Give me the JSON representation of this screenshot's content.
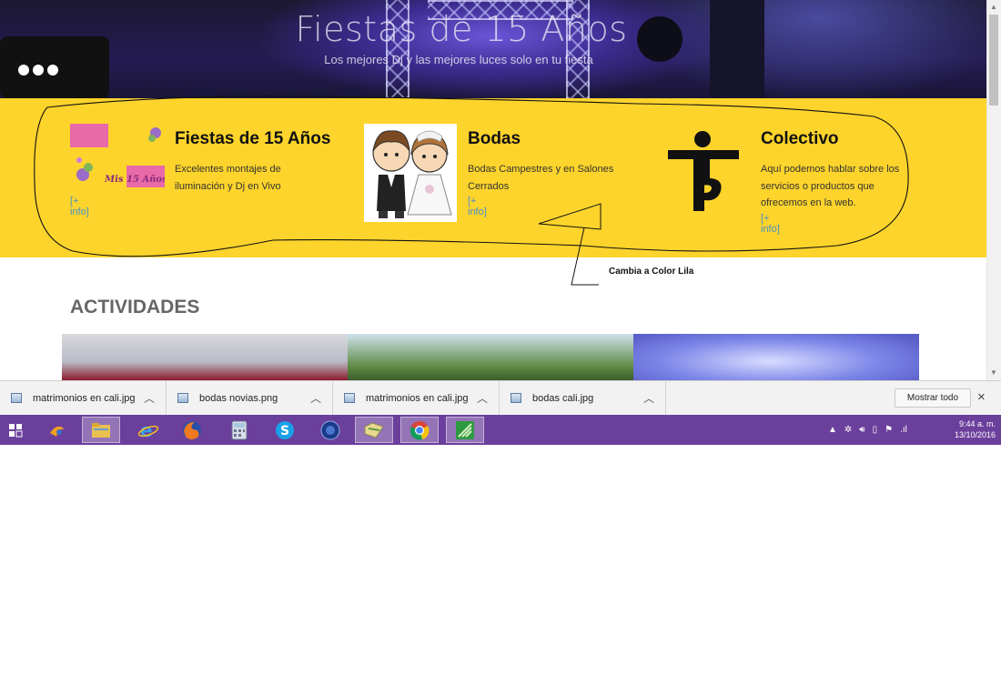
{
  "hero": {
    "title": "Fiestas de 15 Años",
    "subtitle": "Los mejores Dj y las mejores luces solo en tu fiesta"
  },
  "services": [
    {
      "title": "Fiestas de 15 Años",
      "description": "Excelentes montajes de iluminación y Dj en Vivo",
      "link": "[+ info]",
      "image_text": "Mis 15 Años"
    },
    {
      "title": "Bodas",
      "description": "Bodas Campestres y en Salones Cerrados",
      "link": "[+ info]"
    },
    {
      "title": "Colectivo",
      "description": "Aquí podemos hablar sobre los servicios o productos que ofrecemos en la web.",
      "link": "[+ info]"
    }
  ],
  "annotation": {
    "text": "Cambia a Color Lila"
  },
  "section": {
    "title": "ACTIVIDADES"
  },
  "downloads": {
    "items": [
      {
        "name": "matrimonios en cali.jpg"
      },
      {
        "name": "bodas novias.png"
      },
      {
        "name": "matrimonios en cali.jpg"
      },
      {
        "name": "bodas cali.jpg"
      }
    ],
    "show_all": "Mostrar todo",
    "close_icon": "×"
  },
  "taskbar": {
    "clock": {
      "time": "9:44 a. m.",
      "date": "13/10/2016"
    },
    "apps": [
      "start",
      "winamp",
      "file-explorer",
      "internet-explorer",
      "firefox",
      "calculator",
      "skype",
      "globe-app",
      "folder-app",
      "chrome",
      "green-app"
    ]
  },
  "colors": {
    "services_background": "#fdd42b",
    "taskbar": "#6b3f9c",
    "link": "#4a90c8"
  }
}
